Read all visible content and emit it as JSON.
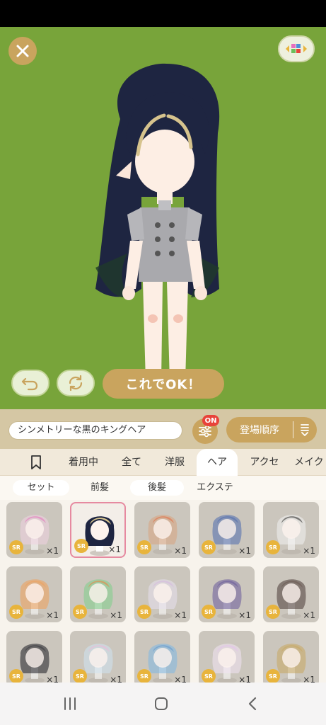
{
  "toolbar": {
    "item_name": "シンメトリーな黒のキングヘア",
    "filter_badge": "ON",
    "sort_label": "登場順序"
  },
  "stage": {
    "ok_label": "これでOK！",
    "background_color": "#78a43a"
  },
  "category_tabs": [
    "着用中",
    "全て",
    "洋服",
    "ヘア",
    "アクセ",
    "メイク"
  ],
  "active_category": "ヘア",
  "sub_tabs": [
    "セット",
    "前髪",
    "後髪",
    "エクステ"
  ],
  "items": [
    {
      "rarity": "SR",
      "qty": "×1",
      "hair": "#f1d2e2",
      "accent": "#e86fbd"
    },
    {
      "rarity": "SR",
      "qty": "×1",
      "hair": "#1e2541",
      "accent": "#d6c38d",
      "selected": true
    },
    {
      "rarity": "SR",
      "qty": "×1",
      "hair": "#d9a47f",
      "accent": "#e46a3f"
    },
    {
      "rarity": "SR",
      "qty": "×1",
      "hair": "#4f6cae",
      "accent": "#4f6cae"
    },
    {
      "rarity": "SR",
      "qty": "×1",
      "hair": "#f2f2f2",
      "accent": "#222222"
    },
    {
      "rarity": "SR",
      "qty": "×1",
      "hair": "#f0a05a",
      "accent": "#f0a05a"
    },
    {
      "rarity": "SR",
      "qty": "×1",
      "hair": "#7fcf8a",
      "accent": "#f0803a"
    },
    {
      "rarity": "SR",
      "qty": "×1",
      "hair": "#e7e0ef",
      "accent": "#d7b6e2"
    },
    {
      "rarity": "SR",
      "qty": "×1",
      "hair": "#6a5a9a",
      "accent": "#6a5a9a"
    },
    {
      "rarity": "SR",
      "qty": "×1",
      "hair": "#4a3a36",
      "accent": "#6b5a50"
    },
    {
      "rarity": "SR",
      "qty": "×1",
      "hair": "#1d1d24",
      "accent": "#3a3a40"
    },
    {
      "rarity": "SR",
      "qty": "×1",
      "hair": "#cfe4f2",
      "accent": "#f3b6d9"
    },
    {
      "rarity": "SR",
      "qty": "×1",
      "hair": "#7fb8e3",
      "accent": "#5f97d1"
    },
    {
      "rarity": "SR",
      "qty": "×1",
      "hair": "#f2e4f4",
      "accent": "#e6c0ef"
    },
    {
      "rarity": "SR",
      "qty": "×1",
      "hair": "#c9a861",
      "accent": "#c9a861"
    }
  ],
  "colors": {
    "accent": "#c9a45e",
    "badge": "#e8433a",
    "selected_border": "#e68aa0"
  },
  "icons": [
    "close-icon",
    "grid-toggle-icon",
    "undo-icon",
    "refresh-icon",
    "filter-sliders-icon",
    "sort-icon",
    "bookmark-icon",
    "recent-apps-icon",
    "home-icon",
    "back-icon"
  ]
}
